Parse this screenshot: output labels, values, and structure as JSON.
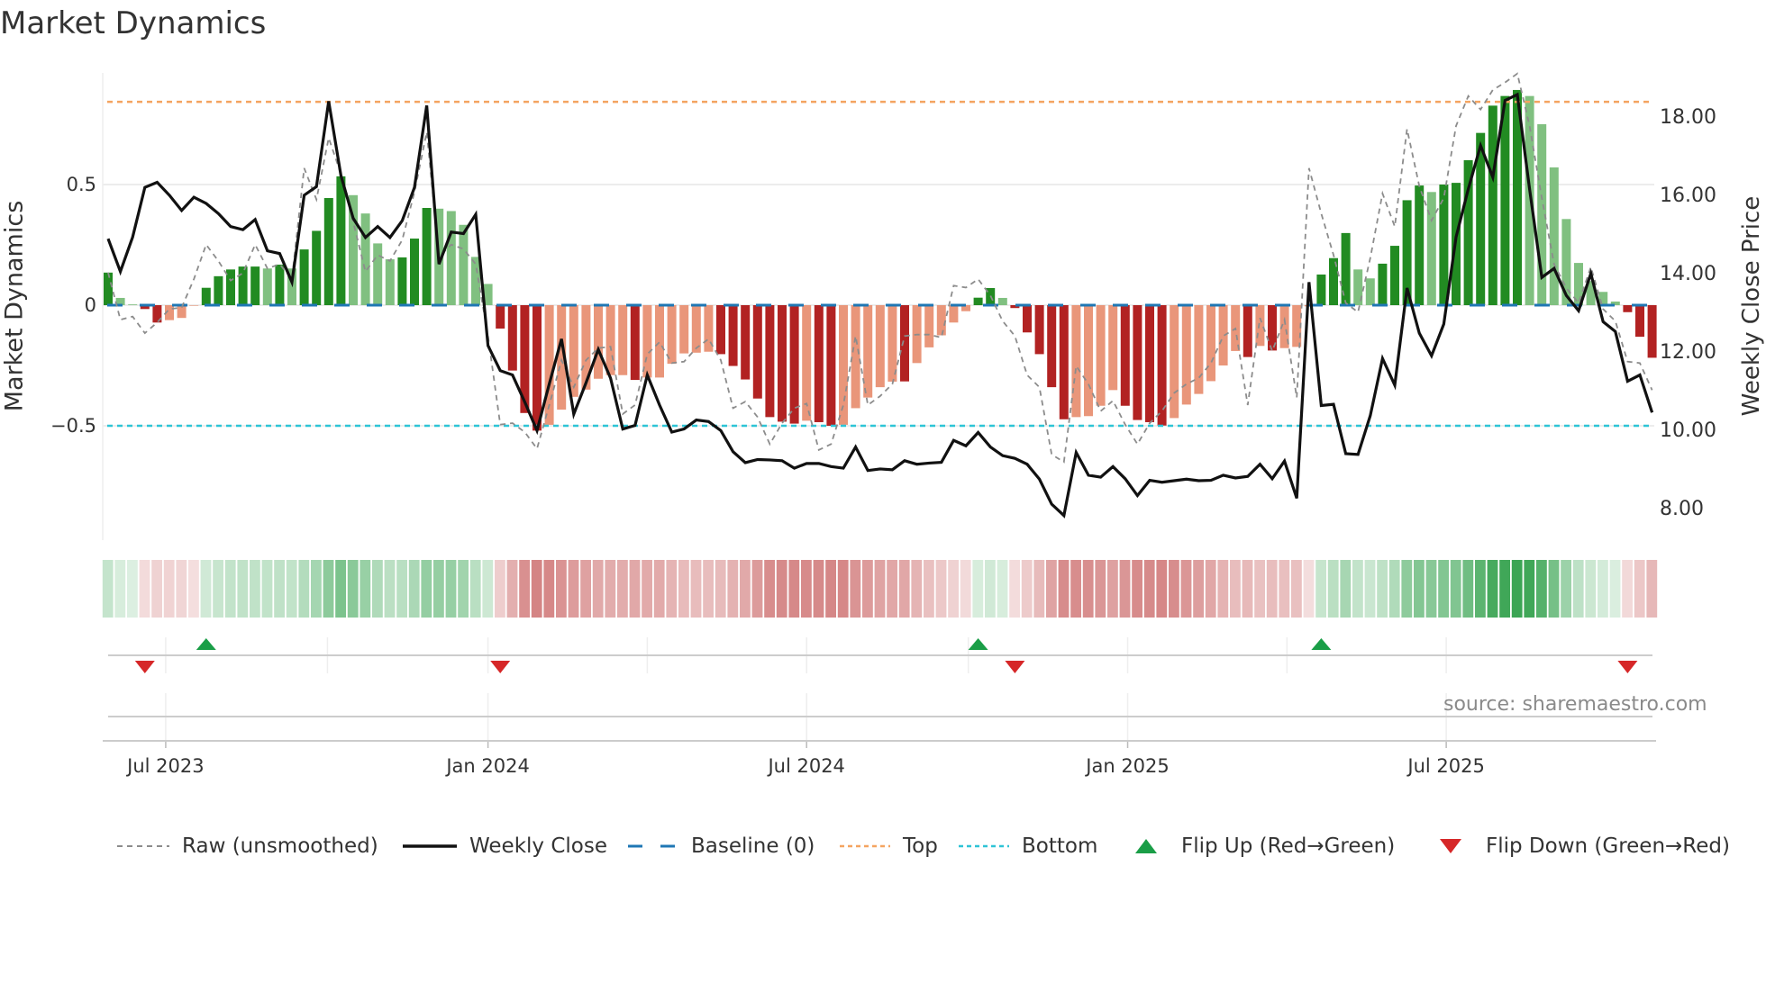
{
  "title": "Market Dynamics",
  "source": "source: sharemaestro.com",
  "colors": {
    "strong_green": "#228b22",
    "weak_green": "#80c080",
    "strong_red": "#b22222",
    "weak_red": "#e9967a",
    "raw": "#8c8c8c",
    "close": "#111111",
    "baseline": "#1f77b4",
    "top": "#f4a460",
    "bottom": "#2ec4d6",
    "flip_up": "#1a9e47",
    "flip_down": "#d62728",
    "heat_green": "#2a9d45",
    "heat_red": "#b83232"
  },
  "legend": [
    {
      "key": "raw",
      "label": "Raw (unsmoothed)"
    },
    {
      "key": "close",
      "label": "Weekly Close"
    },
    {
      "key": "baseline",
      "label": "Baseline (0)"
    },
    {
      "key": "top",
      "label": "Top"
    },
    {
      "key": "bottom",
      "label": "Bottom"
    },
    {
      "key": "flip_up",
      "label": "Flip Up (Red→Green)"
    },
    {
      "key": "flip_down",
      "label": "Flip Down (Green→Red)"
    }
  ],
  "chart_data": {
    "type": "bar",
    "title": "Market Dynamics",
    "ylabel": "Market Dynamics",
    "y2label": "Weekly Close Price",
    "frequency": "weekly",
    "ylim": [
      -1.0,
      0.97
    ],
    "y2lim": [
      7.0,
      19.2
    ],
    "yticks": [
      {
        "value": 0.5,
        "label": "0.5"
      },
      {
        "value": 0,
        "label": "0"
      },
      {
        "value": -0.5,
        "label": "−0.5"
      }
    ],
    "y2ticks": [
      {
        "value": 18,
        "label": "18.00"
      },
      {
        "value": 16,
        "label": "16.00"
      },
      {
        "value": 14,
        "label": "14.00"
      },
      {
        "value": 12,
        "label": "12.00"
      },
      {
        "value": 10,
        "label": "10.00"
      },
      {
        "value": 8,
        "label": "8.00"
      }
    ],
    "xticks": [
      {
        "week": 4.7,
        "label": "Jul 2023"
      },
      {
        "week": 31,
        "label": "Jan 2024"
      },
      {
        "week": 57,
        "label": "Jul 2024"
      },
      {
        "week": 83.2,
        "label": "Jan 2025"
      },
      {
        "week": 109.2,
        "label": "Jul 2025"
      }
    ],
    "quarter_gridlines_week": [
      4.7,
      17.9,
      31,
      44,
      57,
      70.2,
      83.2,
      96.2,
      109.2
    ],
    "top_level": 0.843,
    "bottom_level": -0.5,
    "baseline": 0,
    "momentum": [
      0.135,
      0.03,
      0.003,
      -0.016,
      -0.072,
      -0.062,
      -0.053,
      -0.002,
      0.072,
      0.12,
      0.148,
      0.16,
      0.16,
      0.152,
      0.168,
      0.152,
      0.231,
      0.308,
      0.444,
      0.534,
      0.456,
      0.38,
      0.256,
      0.19,
      0.198,
      0.276,
      0.403,
      0.4,
      0.39,
      0.333,
      0.2,
      0.088,
      -0.097,
      -0.271,
      -0.447,
      -0.52,
      -0.496,
      -0.433,
      -0.38,
      -0.35,
      -0.305,
      -0.29,
      -0.29,
      -0.31,
      -0.3,
      -0.3,
      -0.243,
      -0.2,
      -0.197,
      -0.193,
      -0.203,
      -0.252,
      -0.308,
      -0.387,
      -0.464,
      -0.483,
      -0.491,
      -0.479,
      -0.485,
      -0.5,
      -0.496,
      -0.427,
      -0.383,
      -0.34,
      -0.317,
      -0.316,
      -0.24,
      -0.175,
      -0.125,
      -0.072,
      -0.025,
      0.031,
      0.071,
      0.03,
      -0.012,
      -0.113,
      -0.203,
      -0.34,
      -0.473,
      -0.464,
      -0.46,
      -0.417,
      -0.352,
      -0.417,
      -0.476,
      -0.485,
      -0.499,
      -0.468,
      -0.412,
      -0.368,
      -0.315,
      -0.25,
      -0.19,
      -0.215,
      -0.169,
      -0.188,
      -0.178,
      -0.173,
      -0.005,
      0.127,
      0.195,
      0.299,
      0.148,
      0.111,
      0.172,
      0.246,
      0.435,
      0.496,
      0.469,
      0.5,
      0.507,
      0.601,
      0.714,
      0.827,
      0.867,
      0.892,
      0.867,
      0.75,
      0.571,
      0.357,
      0.175,
      0.1,
      0.055,
      0.015,
      -0.029,
      -0.131,
      -0.218
    ],
    "momentum_strength": "GggRRrrrGGGGGgGgGGGGggggGGGgggggRRRRrrrrrrrRrrrrrrRRRRRRRrRRrrrrrRrrrrrGGgRRRRRrrrrRRRRrrrrrrRrRrrrGGGggGGGGgGGGGGGGggggggggRRR",
    "raw": [
      0.135,
      -0.06,
      -0.047,
      -0.116,
      -0.072,
      -0.016,
      -0.01,
      0.108,
      0.251,
      0.183,
      0.102,
      0.133,
      0.251,
      0.152,
      0.17,
      0.108,
      0.568,
      0.438,
      0.693,
      0.544,
      0.345,
      0.139,
      0.208,
      0.183,
      0.27,
      0.469,
      0.718,
      0.2,
      0.251,
      0.233,
      0.17,
      -0.128,
      -0.495,
      -0.489,
      -0.526,
      -0.595,
      -0.414,
      -0.228,
      -0.34,
      -0.228,
      -0.178,
      -0.172,
      -0.451,
      -0.414,
      -0.203,
      -0.153,
      -0.24,
      -0.234,
      -0.178,
      -0.14,
      -0.228,
      -0.427,
      -0.4,
      -0.464,
      -0.576,
      -0.489,
      -0.427,
      -0.408,
      -0.6,
      -0.576,
      -0.414,
      -0.128,
      -0.414,
      -0.377,
      -0.327,
      -0.128,
      -0.122,
      -0.122,
      -0.134,
      0.081,
      0.073,
      0.108,
      0.04,
      -0.066,
      -0.128,
      -0.29,
      -0.34,
      -0.619,
      -0.65,
      -0.252,
      -0.327,
      -0.439,
      -0.396,
      -0.495,
      -0.576,
      -0.489,
      -0.439,
      -0.364,
      -0.327,
      -0.302,
      -0.24,
      -0.128,
      -0.097,
      -0.414,
      -0.053,
      -0.19,
      -0.06,
      -0.383,
      0.568,
      0.38,
      0.208,
      0.009,
      -0.029,
      0.195,
      0.463,
      0.326,
      0.73,
      0.494,
      0.351,
      0.444,
      0.743,
      0.867,
      0.811,
      0.892,
      0.923,
      0.96,
      0.743,
      0.444,
      0.17,
      0.071,
      0.009,
      0.158,
      -0.016,
      -0.066,
      -0.234,
      -0.24,
      -0.352
    ],
    "weekly_close": [
      14.87,
      14.03,
      14.91,
      16.18,
      16.31,
      15.98,
      15.59,
      15.93,
      15.77,
      15.51,
      15.18,
      15.1,
      15.36,
      14.56,
      14.49,
      13.76,
      15.98,
      16.2,
      18.38,
      16.48,
      15.39,
      14.9,
      15.18,
      14.9,
      15.33,
      16.18,
      18.27,
      14.22,
      15.04,
      15.0,
      15.49,
      12.14,
      11.5,
      11.39,
      10.7,
      9.97,
      11.16,
      12.31,
      10.39,
      11.19,
      12.04,
      11.31,
      10.01,
      10.1,
      11.39,
      10.62,
      9.93,
      10.01,
      10.24,
      10.2,
      9.97,
      9.43,
      9.15,
      9.23,
      9.22,
      9.2,
      9.01,
      9.13,
      9.13,
      9.05,
      9.01,
      9.55,
      8.95,
      8.99,
      8.97,
      9.2,
      9.11,
      9.14,
      9.16,
      9.72,
      9.58,
      9.92,
      9.55,
      9.33,
      9.26,
      9.11,
      8.73,
      8.09,
      7.8,
      9.41,
      8.83,
      8.78,
      9.05,
      8.74,
      8.31,
      8.7,
      8.65,
      8.69,
      8.73,
      8.69,
      8.7,
      8.83,
      8.76,
      8.8,
      9.11,
      8.74,
      9.19,
      8.24,
      13.76,
      10.61,
      10.64,
      9.38,
      9.36,
      10.35,
      11.81,
      11.13,
      13.61,
      12.46,
      11.88,
      12.69,
      14.91,
      16.14,
      17.25,
      16.44,
      18.4,
      18.55,
      16.14,
      13.88,
      14.11,
      13.42,
      13.03,
      13.98,
      12.75,
      12.5,
      11.23,
      11.39,
      10.43
    ],
    "flips": [
      {
        "week": 3,
        "type": "down"
      },
      {
        "week": 8,
        "type": "up"
      },
      {
        "week": 32,
        "type": "down"
      },
      {
        "week": 71,
        "type": "up"
      },
      {
        "week": 74,
        "type": "down"
      },
      {
        "week": 99,
        "type": "up"
      },
      {
        "week": 124,
        "type": "down"
      }
    ]
  }
}
